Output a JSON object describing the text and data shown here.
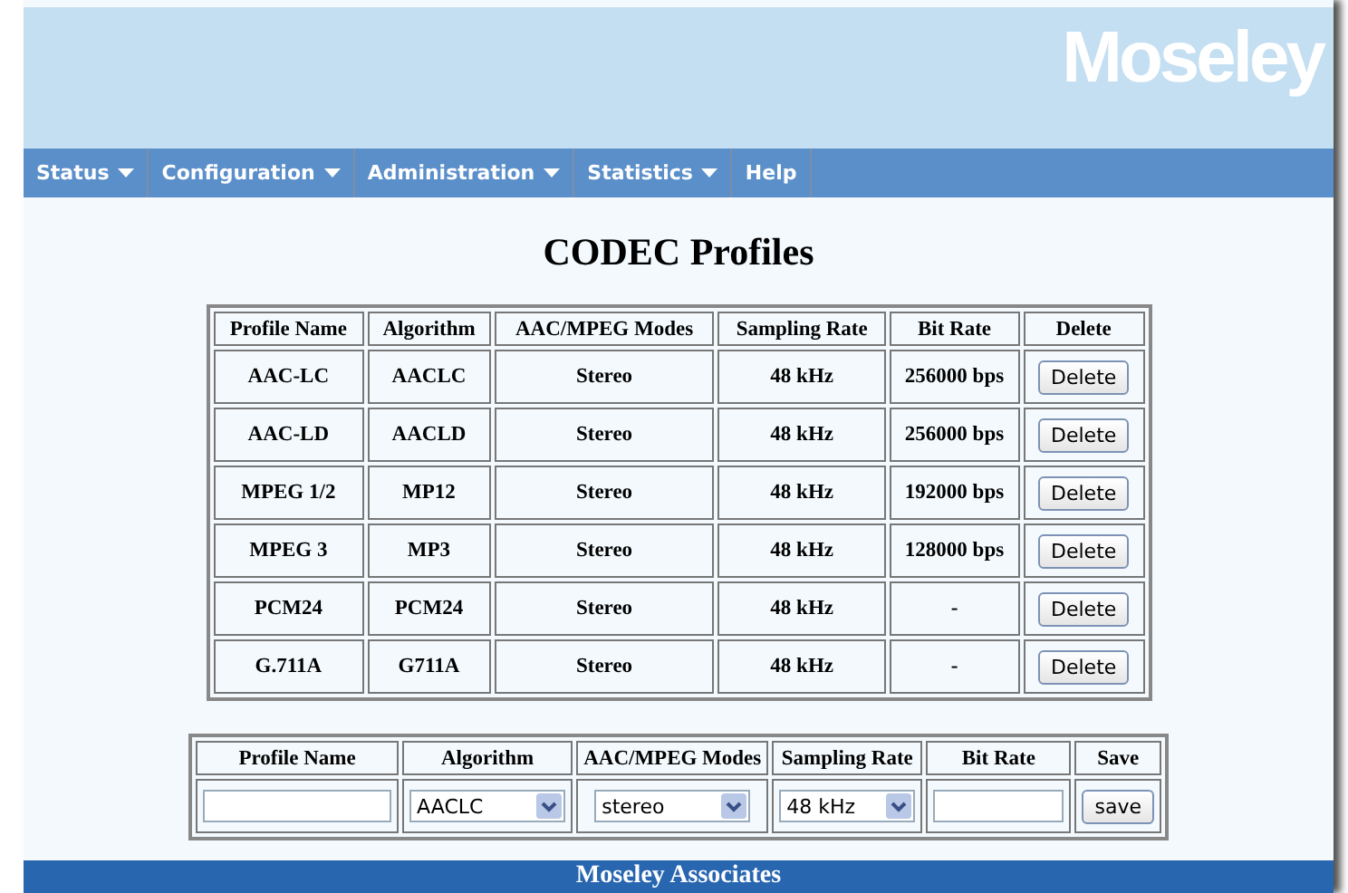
{
  "header": {
    "logo": "Moseley"
  },
  "nav": [
    {
      "label": "Status",
      "dropdown": true
    },
    {
      "label": "Configuration",
      "dropdown": true
    },
    {
      "label": "Administration",
      "dropdown": true
    },
    {
      "label": "Statistics",
      "dropdown": true
    },
    {
      "label": "Help",
      "dropdown": false
    }
  ],
  "title": "CODEC Profiles",
  "table": {
    "columns": [
      "Profile Name",
      "Algorithm",
      "AAC/MPEG Modes",
      "Sampling Rate",
      "Bit Rate",
      "Delete"
    ],
    "rows": [
      {
        "cells": [
          "AAC-LC",
          "AACLC",
          "Stereo",
          "48 kHz",
          "256000 bps"
        ],
        "button": "Delete"
      },
      {
        "cells": [
          "AAC-LD",
          "AACLD",
          "Stereo",
          "48 kHz",
          "256000 bps"
        ],
        "button": "Delete"
      },
      {
        "cells": [
          "MPEG 1/2",
          "MP12",
          "Stereo",
          "48 kHz",
          "192000 bps"
        ],
        "button": "Delete"
      },
      {
        "cells": [
          "MPEG 3",
          "MP3",
          "Stereo",
          "48 kHz",
          "128000 bps"
        ],
        "button": "Delete"
      },
      {
        "cells": [
          "PCM24",
          "PCM24",
          "Stereo",
          "48 kHz",
          "-"
        ],
        "button": "Delete"
      },
      {
        "cells": [
          "G.711A",
          "G711A",
          "Stereo",
          "48 kHz",
          "-"
        ],
        "button": "Delete"
      }
    ]
  },
  "form": {
    "columns": [
      "Profile Name",
      "Algorithm",
      "AAC/MPEG Modes",
      "Sampling Rate",
      "Bit Rate",
      "Save"
    ],
    "fields": [
      {
        "kind": "text"
      },
      {
        "kind": "select",
        "value": "AACLC"
      },
      {
        "kind": "select",
        "value": "stereo"
      },
      {
        "kind": "select",
        "value": "48 kHz"
      },
      {
        "kind": "text"
      },
      {
        "kind": "button",
        "label": "save"
      }
    ]
  },
  "footer": "Moseley Associates"
}
